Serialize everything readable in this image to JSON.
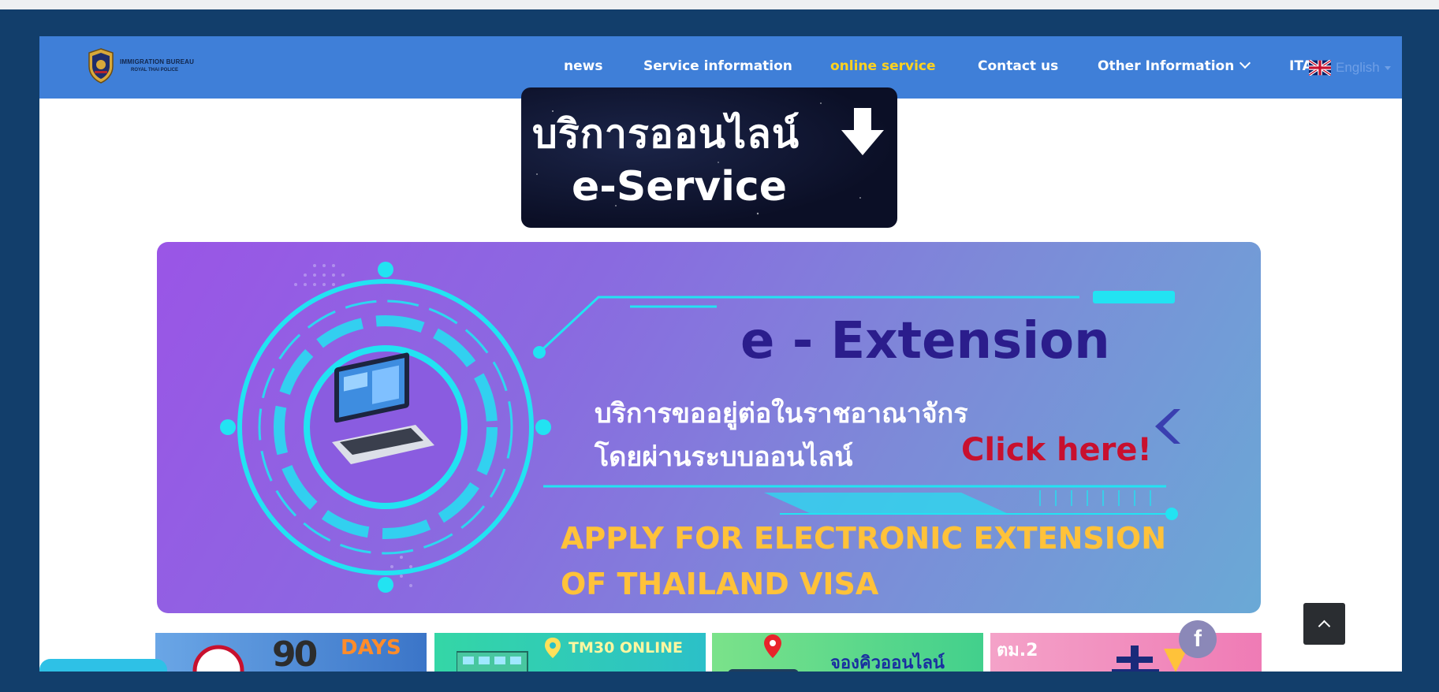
{
  "nav": {
    "logo_line1": "IMMIGRATION BUREAU",
    "logo_line2": "ROYAL THAI POLICE",
    "items": [
      {
        "label": "news"
      },
      {
        "label": "Service information"
      },
      {
        "label": "online service"
      },
      {
        "label": "Contact us"
      },
      {
        "label": "Other Information"
      },
      {
        "label": "ITA"
      }
    ],
    "active_item": "online service",
    "language": "English"
  },
  "eservice_banner": {
    "thai": "บริการออนไลน์",
    "english": "e-Service"
  },
  "extension_banner": {
    "title": "e - Extension",
    "thai_line1": "บริการขออยู่ต่อในราชอาณาจักร",
    "thai_line2": "โดยผ่านระบบออนไลน์",
    "cta": "Click here!",
    "apply_line1": "APPLY FOR ELECTRONIC EXTENSION",
    "apply_line2": "OF THAILAND VISA"
  },
  "cards": [
    {
      "number": "90",
      "label": "DAYS"
    },
    {
      "label": "TM30 ONLINE"
    },
    {
      "label": "จองคิวออนไลน์"
    },
    {
      "label": "ตม.2"
    }
  ],
  "facebook_label": "f",
  "colors": {
    "page_border": "#123e6b",
    "navbar": "#3f7fd8",
    "active_menu": "#ffd21e",
    "cta_red": "#c8102e",
    "apply_yellow": "#ffc23a",
    "title_navy": "#2b1d8c"
  }
}
